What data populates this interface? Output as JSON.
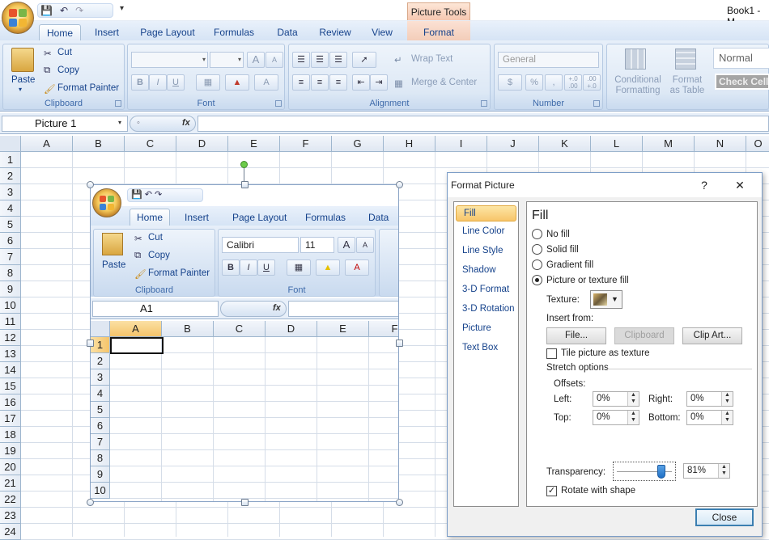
{
  "app": {
    "title": "Book1 - M",
    "contextual_tab_group": "Picture Tools"
  },
  "tabs": [
    "Home",
    "Insert",
    "Page Layout",
    "Formulas",
    "Data",
    "Review",
    "View",
    "Format"
  ],
  "ribbon": {
    "clipboard": {
      "label": "Clipboard",
      "paste": "Paste",
      "cut": "Cut",
      "copy": "Copy",
      "format_painter": "Format Painter"
    },
    "font": {
      "label": "Font",
      "bold": "B",
      "italic": "I",
      "underline": "U",
      "grow": "A",
      "shrink": "A",
      "font_color": "A"
    },
    "alignment": {
      "label": "Alignment",
      "wrap_text": "Wrap Text",
      "merge_center": "Merge & Center"
    },
    "number": {
      "label": "Number",
      "format": "General",
      "currency": "$",
      "percent": "%",
      "comma": ",",
      "inc_decimal": "+.0 .00",
      "dec_decimal": ".00 +.0"
    },
    "styles": {
      "conditional": "Conditional Formatting",
      "format_table": "Format as Table",
      "normal": "Normal",
      "check_cell": "Check Cell"
    }
  },
  "formula_bar": {
    "name_box": "Picture 1",
    "fx": "fx"
  },
  "columns": [
    "A",
    "B",
    "C",
    "D",
    "E",
    "F",
    "G",
    "H",
    "I",
    "J",
    "K",
    "L",
    "M",
    "N",
    "O"
  ],
  "rows": [
    "1",
    "2",
    "3",
    "4",
    "5",
    "6",
    "7",
    "8",
    "9",
    "10",
    "11",
    "12",
    "13",
    "14",
    "15",
    "16",
    "17",
    "18",
    "19",
    "20",
    "21",
    "22",
    "23",
    "24"
  ],
  "picture": {
    "tabs": [
      "Home",
      "Insert",
      "Page Layout",
      "Formulas",
      "Data"
    ],
    "clipboard": {
      "paste": "Paste",
      "cut": "Cut",
      "copy": "Copy",
      "format_painter": "Format Painter",
      "label": "Clipboard"
    },
    "font": {
      "name": "Calibri",
      "size": "11",
      "label": "Font",
      "bold": "B",
      "italic": "I",
      "underline": "U",
      "grow": "A",
      "shrink": "A",
      "font_color": "A"
    },
    "name_box": "A1",
    "fx": "fx",
    "columns": [
      "A",
      "B",
      "C",
      "D",
      "E",
      "F"
    ],
    "rows": [
      "1",
      "2",
      "3",
      "4",
      "5",
      "6",
      "7",
      "8",
      "9",
      "10"
    ]
  },
  "dialog": {
    "title": "Format Picture",
    "help": "?",
    "close_x": "✕",
    "nav": [
      "Fill",
      "Line Color",
      "Line Style",
      "Shadow",
      "3-D Format",
      "3-D Rotation",
      "Picture",
      "Text Box"
    ],
    "selected_nav": "Fill",
    "heading": "Fill",
    "options": [
      "No fill",
      "Solid fill",
      "Gradient fill",
      "Picture or texture fill"
    ],
    "selected_option": "Picture or texture fill",
    "texture_label": "Texture:",
    "insert_from": "Insert from:",
    "file_button": "File...",
    "clipboard_button": "Clipboard",
    "clipart_button": "Clip Art...",
    "tile_label": "Tile picture as texture",
    "tile_checked": false,
    "stretch_options": "Stretch options",
    "offsets": "Offsets:",
    "left_label": "Left:",
    "left_value": "0%",
    "right_label": "Right:",
    "right_value": "0%",
    "top_label": "Top:",
    "top_value": "0%",
    "bottom_label": "Bottom:",
    "bottom_value": "0%",
    "transparency_label": "Transparency:",
    "transparency_value": "81%",
    "transparency_fraction": 0.81,
    "rotate_label": "Rotate with shape",
    "rotate_checked": true,
    "close_button": "Close"
  }
}
